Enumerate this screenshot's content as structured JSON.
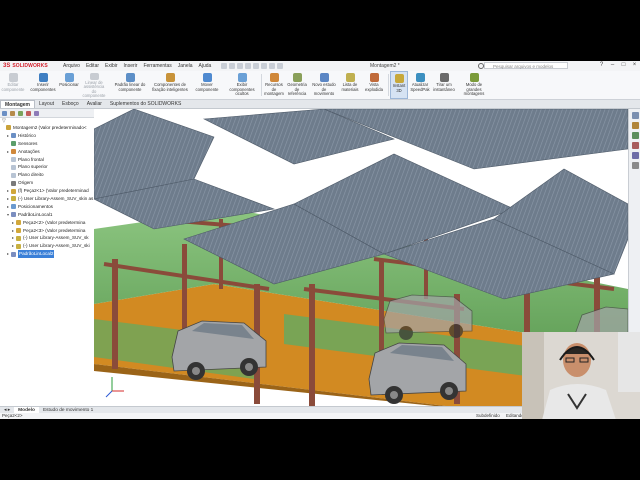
{
  "app": {
    "logo_ds": "3S",
    "logo_text": "SOLIDWORKS",
    "menu": [
      "Arquivo",
      "Editar",
      "Exibir",
      "Inserir",
      "Ferramentas",
      "Janela",
      "Ajuda"
    ],
    "document_title": "Montagem2 *",
    "search_placeholder": "Pesquisar arquivos e modelos"
  },
  "ribbon": [
    {
      "label": "Editar\ncomponente",
      "icon": "edit-component-icon",
      "disabled": true
    },
    {
      "label": "Inserir componentes",
      "icon": "insert-components-icon"
    },
    {
      "label": "Posicionar",
      "icon": "mate-icon"
    },
    {
      "label": "Linear de assistência\ndo componente",
      "icon": "linear-pattern-icon",
      "disabled": true
    },
    {
      "label": "Padrão linear do componente",
      "icon": "pattern-icon"
    },
    {
      "label": "Componentes de\nfixação inteligentes",
      "icon": "smart-fasteners-icon"
    },
    {
      "label": "Mover componente",
      "icon": "move-component-icon"
    },
    {
      "label": "Exibir componentes\nocultos",
      "icon": "show-hidden-icon"
    },
    {
      "label": "Recursos de\nmontagem",
      "icon": "assembly-features-icon"
    },
    {
      "label": "Geometria de\nreferência",
      "icon": "reference-geometry-icon"
    },
    {
      "label": "Novo estudo\nde movimento",
      "icon": "motion-study-icon"
    },
    {
      "label": "Lista de\nmateriais",
      "icon": "bom-icon"
    },
    {
      "label": "Vista explodida",
      "icon": "exploded-view-icon"
    },
    {
      "label": "Instant\n3D",
      "icon": "instant3d-icon",
      "active": true
    },
    {
      "label": "Atualizar\nSpeedPak",
      "icon": "speedpak-icon"
    },
    {
      "label": "Tirar um\ninstantâneo",
      "icon": "snapshot-icon"
    },
    {
      "label": "Modo de grandes\nmontagens",
      "icon": "large-assembly-icon"
    }
  ],
  "tabs": [
    "Montagem",
    "Layout",
    "Esboço",
    "Avaliar",
    "Suplementos do SOLIDWORKS"
  ],
  "tree": [
    {
      "label": "Montagem2  (Valor predeterminado<",
      "icon": "assembly-icon",
      "indent": 0,
      "expander": ""
    },
    {
      "label": "Histórico",
      "icon": "history-icon",
      "indent": 1,
      "expander": "▸"
    },
    {
      "label": "Sensores",
      "icon": "sensor-icon",
      "indent": 1,
      "expander": ""
    },
    {
      "label": "Anotações",
      "icon": "annotation-icon",
      "indent": 1,
      "expander": "▸"
    },
    {
      "label": "Plano frontal",
      "icon": "plane-icon",
      "indent": 1,
      "expander": ""
    },
    {
      "label": "Plano superior",
      "icon": "plane-icon",
      "indent": 1,
      "expander": ""
    },
    {
      "label": "Plano direito",
      "icon": "plane-icon",
      "indent": 1,
      "expander": ""
    },
    {
      "label": "Origem",
      "icon": "origin-icon",
      "indent": 1,
      "expander": ""
    },
    {
      "label": "(f) Peça2<1> (Valor predeterminad",
      "icon": "part-icon",
      "indent": 1,
      "expander": "▸"
    },
    {
      "label": "(-) User Library-Assem_SUV_skin as",
      "icon": "subassembly-icon",
      "indent": 1,
      "expander": "▸"
    },
    {
      "label": "Posicionamentos",
      "icon": "mates-icon",
      "indent": 1,
      "expander": "▸"
    },
    {
      "label": "PadrãoLinLocal1",
      "icon": "pattern-feature-icon",
      "indent": 1,
      "expander": "▾"
    },
    {
      "label": "Peça2<2> (Valor predetermina",
      "icon": "part-icon",
      "indent": 2,
      "expander": "▸"
    },
    {
      "label": "Peça2<3> (Valor predetermina",
      "icon": "part-icon",
      "indent": 2,
      "expander": "▸"
    },
    {
      "label": "(-) User Library-Assem_SUV_sk",
      "icon": "subassembly-icon",
      "indent": 2,
      "expander": "▸"
    },
    {
      "label": "(-) User Library-Assem_SUV_ski",
      "icon": "subassembly-icon",
      "indent": 2,
      "expander": "▸"
    },
    {
      "label": "PadrãoLinLocal2",
      "icon": "pattern-feature-icon",
      "indent": 1,
      "expander": "▸",
      "selected": true
    }
  ],
  "bottom_tabs": [
    "Modelo",
    "Estudo de movimento 1"
  ],
  "status": {
    "left": "Peça2<2>",
    "state": "Subdefinido",
    "mode": "Editando"
  },
  "colors": {
    "roof": "#6e7c8c",
    "frame": "#8a4b3a",
    "floor": "#d28a22",
    "wall": "#76b06a",
    "car": "#a3a5a8",
    "selection": "#3b80d8"
  }
}
